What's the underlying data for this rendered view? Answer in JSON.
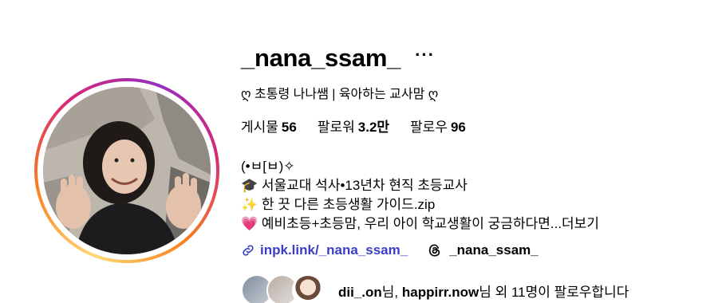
{
  "profile": {
    "username": "_nana_ssam_",
    "more_icon": "more-horizontal-icon",
    "full_name": "ღ 초통령 나나쌤 | 육아하는 교사맘 ღ",
    "stats": [
      {
        "label": "게시물",
        "value": "56"
      },
      {
        "label": "팔로워",
        "value": "3.2만"
      },
      {
        "label": "팔로우",
        "value": "96"
      }
    ],
    "bio": {
      "line1": "(•ㅂ[ㅂ)✧",
      "line2": "🎓 서울교대 석사•13년차 현직 초등교사",
      "line3": "✨ 한 끗 다른 초등생활 가이드.zip",
      "line4_text": "💗 예비초등+초등맘, 우리 아이 학교생활이 궁금하다면...",
      "line4_more": "더보기"
    },
    "links": {
      "website": "inpk.link/_nana_ssam_",
      "threads": "_nana_ssam_"
    },
    "followed_by": {
      "names": "dii_.on",
      "sep1": "님, ",
      "names2": "happirr.now",
      "rest": "님 외 11명이 팔로우합니다"
    }
  },
  "colors": {
    "link": "#3a3ec6",
    "ring_gradient": [
      "#feda75",
      "#fa7e1e",
      "#d62976",
      "#962fbf"
    ]
  }
}
